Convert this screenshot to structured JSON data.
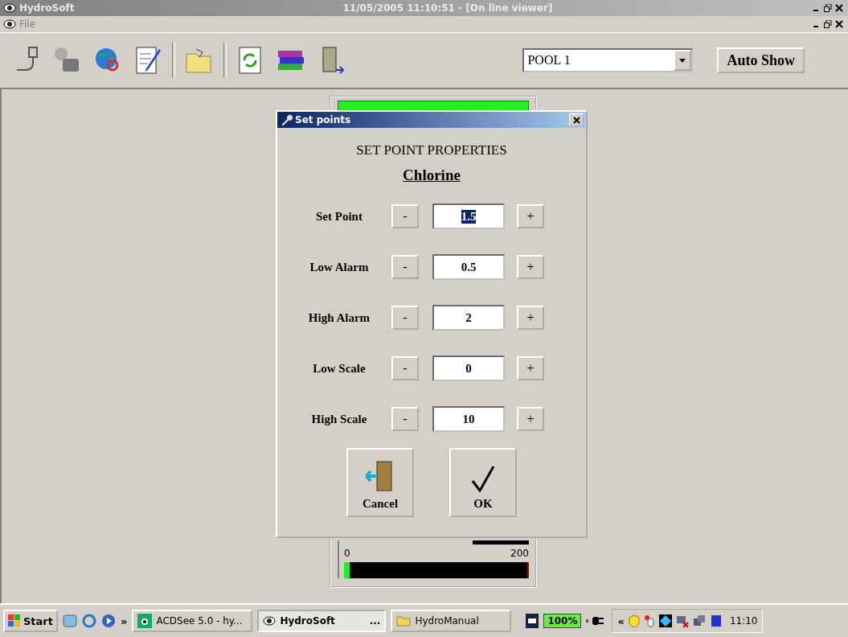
{
  "window": {
    "title": "HydroSoft",
    "caption": "11/05/2005 11:10:51 - [On line viewer]"
  },
  "menu": [
    {
      "label": "File"
    }
  ],
  "toolbar": {
    "pool_select": {
      "value": "POOL 1"
    },
    "auto_show": "Auto Show"
  },
  "background_panel": {
    "scale_min": "0",
    "scale_max": "200",
    "level": 0.03
  },
  "dialog": {
    "title": "Set points",
    "heading": "SET POINT PROPERTIES",
    "subject": "Chlorine",
    "rows": [
      {
        "label": "Set Point",
        "minus": "-",
        "value": "1.5",
        "plus": "+",
        "selected": true
      },
      {
        "label": "Low Alarm",
        "minus": "-",
        "value": "0.5",
        "plus": "+",
        "selected": false
      },
      {
        "label": "High Alarm",
        "minus": "-",
        "value": "2",
        "plus": "+",
        "selected": false
      },
      {
        "label": "Low Scale",
        "minus": "-",
        "value": "0",
        "plus": "+",
        "selected": false
      },
      {
        "label": "High Scale",
        "minus": "-",
        "value": "10",
        "plus": "+",
        "selected": false
      }
    ],
    "buttons": [
      {
        "kind": "cancel",
        "label": "Cancel"
      },
      {
        "kind": "ok",
        "label": "OK"
      }
    ]
  },
  "taskbar": {
    "start": "Start",
    "overflow": "»",
    "tasks": [
      {
        "label": "ACDSee 5.0 - hy...",
        "kind": "viewer",
        "active": false
      },
      {
        "label": "HydroSoft",
        "kind": "app",
        "more": "...",
        "active": true
      },
      {
        "label": "HydroManual",
        "kind": "folder",
        "active": false
      }
    ],
    "battery": "100%",
    "tray_toggle": "«",
    "clock": "11:10"
  }
}
